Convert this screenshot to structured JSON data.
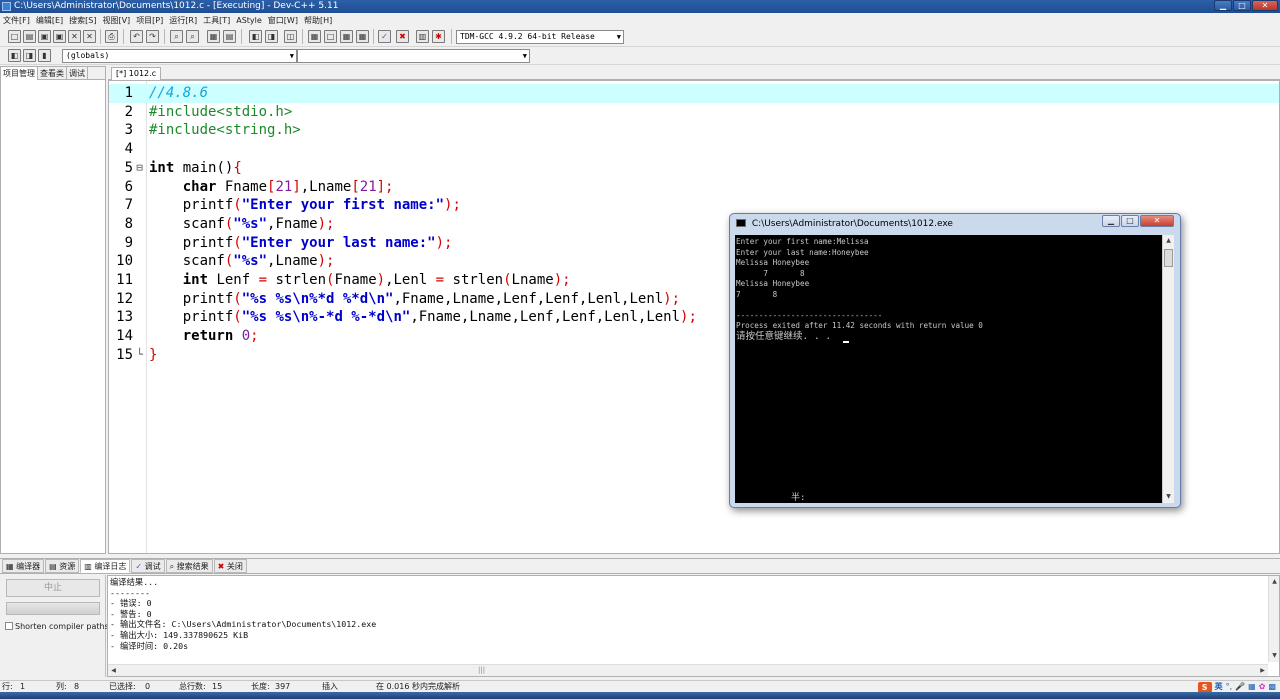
{
  "window": {
    "title": "C:\\Users\\Administrator\\Documents\\1012.c - [Executing] - Dev-C++ 5.11",
    "buttons": {
      "minimize": "▁",
      "maximize": "□",
      "close": "✕"
    }
  },
  "menu": [
    "文件[F]",
    "编辑[E]",
    "搜索[S]",
    "视图[V]",
    "项目[P]",
    "运行[R]",
    "工具[T]",
    "AStyle",
    "窗口[W]",
    "帮助[H]"
  ],
  "toolbar": {
    "compiler": "TDM-GCC 4.9.2 64-bit Release",
    "scope": "(globals)",
    "function": ""
  },
  "left_panel": {
    "tabs": [
      "项目管理",
      "查看类",
      "调试"
    ]
  },
  "editor": {
    "file_tab": "[*] 1012.c",
    "lines": [
      {
        "n": "1",
        "fold": "",
        "html": "<span class='c-comment'>//4.8.6</span>"
      },
      {
        "n": "2",
        "fold": "",
        "html": "<span class='c-pre'>#include&lt;stdio.h&gt;</span>"
      },
      {
        "n": "3",
        "fold": "",
        "html": "<span class='c-pre'>#include&lt;string.h&gt;</span>"
      },
      {
        "n": "4",
        "fold": "",
        "html": ""
      },
      {
        "n": "5",
        "fold": "⊟",
        "html": "<span class='c-kw'>int</span> main()<span class='c-sym'>{</span>"
      },
      {
        "n": "6",
        "fold": "",
        "html": "    <span class='c-kw'>char</span> Fname<span class='c-sym'>[</span><span class='c-num'>21</span><span class='c-sym'>]</span>,Lname<span class='c-sym'>[</span><span class='c-num'>21</span><span class='c-sym'>];</span>"
      },
      {
        "n": "7",
        "fold": "",
        "html": "    printf<span class='c-sym'>(</span><span class='c-str'>\"Enter your first name:\"</span><span class='c-sym'>);</span>"
      },
      {
        "n": "8",
        "fold": "",
        "html": "    scanf<span class='c-sym'>(</span><span class='c-str'>\"%s\"</span>,Fname<span class='c-sym'>);</span>"
      },
      {
        "n": "9",
        "fold": "",
        "html": "    printf<span class='c-sym'>(</span><span class='c-str'>\"Enter your last name:\"</span><span class='c-sym'>);</span>"
      },
      {
        "n": "10",
        "fold": "",
        "html": "    scanf<span class='c-sym'>(</span><span class='c-str'>\"%s\"</span>,Lname<span class='c-sym'>);</span>"
      },
      {
        "n": "11",
        "fold": "",
        "html": "    <span class='c-kw'>int</span> Lenf <span class='c-sym'>=</span> strlen<span class='c-sym'>(</span>Fname<span class='c-sym'>)</span>,Lenl <span class='c-sym'>=</span> strlen<span class='c-sym'>(</span>Lname<span class='c-sym'>);</span>"
      },
      {
        "n": "12",
        "fold": "",
        "html": "    printf<span class='c-sym'>(</span><span class='c-str'>\"%s %s\\n%*d %*d\\n\"</span>,Fname,Lname,Lenf,Lenf,Lenl,Lenl<span class='c-sym'>);</span>"
      },
      {
        "n": "13",
        "fold": "",
        "html": "    printf<span class='c-sym'>(</span><span class='c-str'>\"%s %s\\n%-*d %-*d\\n\"</span>,Fname,Lname,Lenf,Lenf,Lenl,Lenl<span class='c-sym'>);</span>"
      },
      {
        "n": "14",
        "fold": "",
        "html": "    <span class='c-kw'>return</span> <span class='c-num'>0</span><span class='c-sym'>;</span>"
      },
      {
        "n": "15",
        "fold": "└",
        "html": "<span class='c-sym'>}</span>"
      }
    ]
  },
  "console": {
    "title": "C:\\Users\\Administrator\\Documents\\1012.exe",
    "lines": [
      "Enter your first name:Melissa",
      "Enter your last name:Honeybee",
      "Melissa Honeybee",
      "      7       8",
      "Melissa Honeybee",
      "7       8",
      "",
      "--------------------------------",
      "Process exited after 11.42 seconds with return value 0",
      "请按任意键继续. . ."
    ],
    "ime_text": "半:"
  },
  "bottom_panel": {
    "tabs": [
      "编译器",
      "资源",
      "编译日志",
      "调试",
      "搜索结果",
      "关闭"
    ],
    "stop_label": "中止",
    "shorten_label": "Shorten compiler paths",
    "log_lines": [
      "编译结果...",
      "--------",
      "- 错误: 0",
      "- 警告: 0",
      "- 输出文件名: C:\\Users\\Administrator\\Documents\\1012.exe",
      "- 输出大小: 149.337890625 KiB",
      "- 编译时间: 0.20s"
    ]
  },
  "status": {
    "row": "行:",
    "row_val": "1",
    "col": "列:",
    "col_val": "8",
    "sel": "已选择:",
    "sel_val": "0",
    "total": "总行数:",
    "total_val": "15",
    "len": "长度:",
    "len_val": "397",
    "mode": "插入",
    "parse": "在 0.016 秒内完成解析"
  },
  "tray": {
    "ime_logo": "S",
    "lang": "英"
  },
  "colors": {
    "current_line": "#ccffff",
    "comment": "#0da6e0",
    "preprocessor": "#1c8a2b",
    "string": "#0000cc",
    "symbol": "#d50000",
    "number": "#7b1fa2"
  }
}
